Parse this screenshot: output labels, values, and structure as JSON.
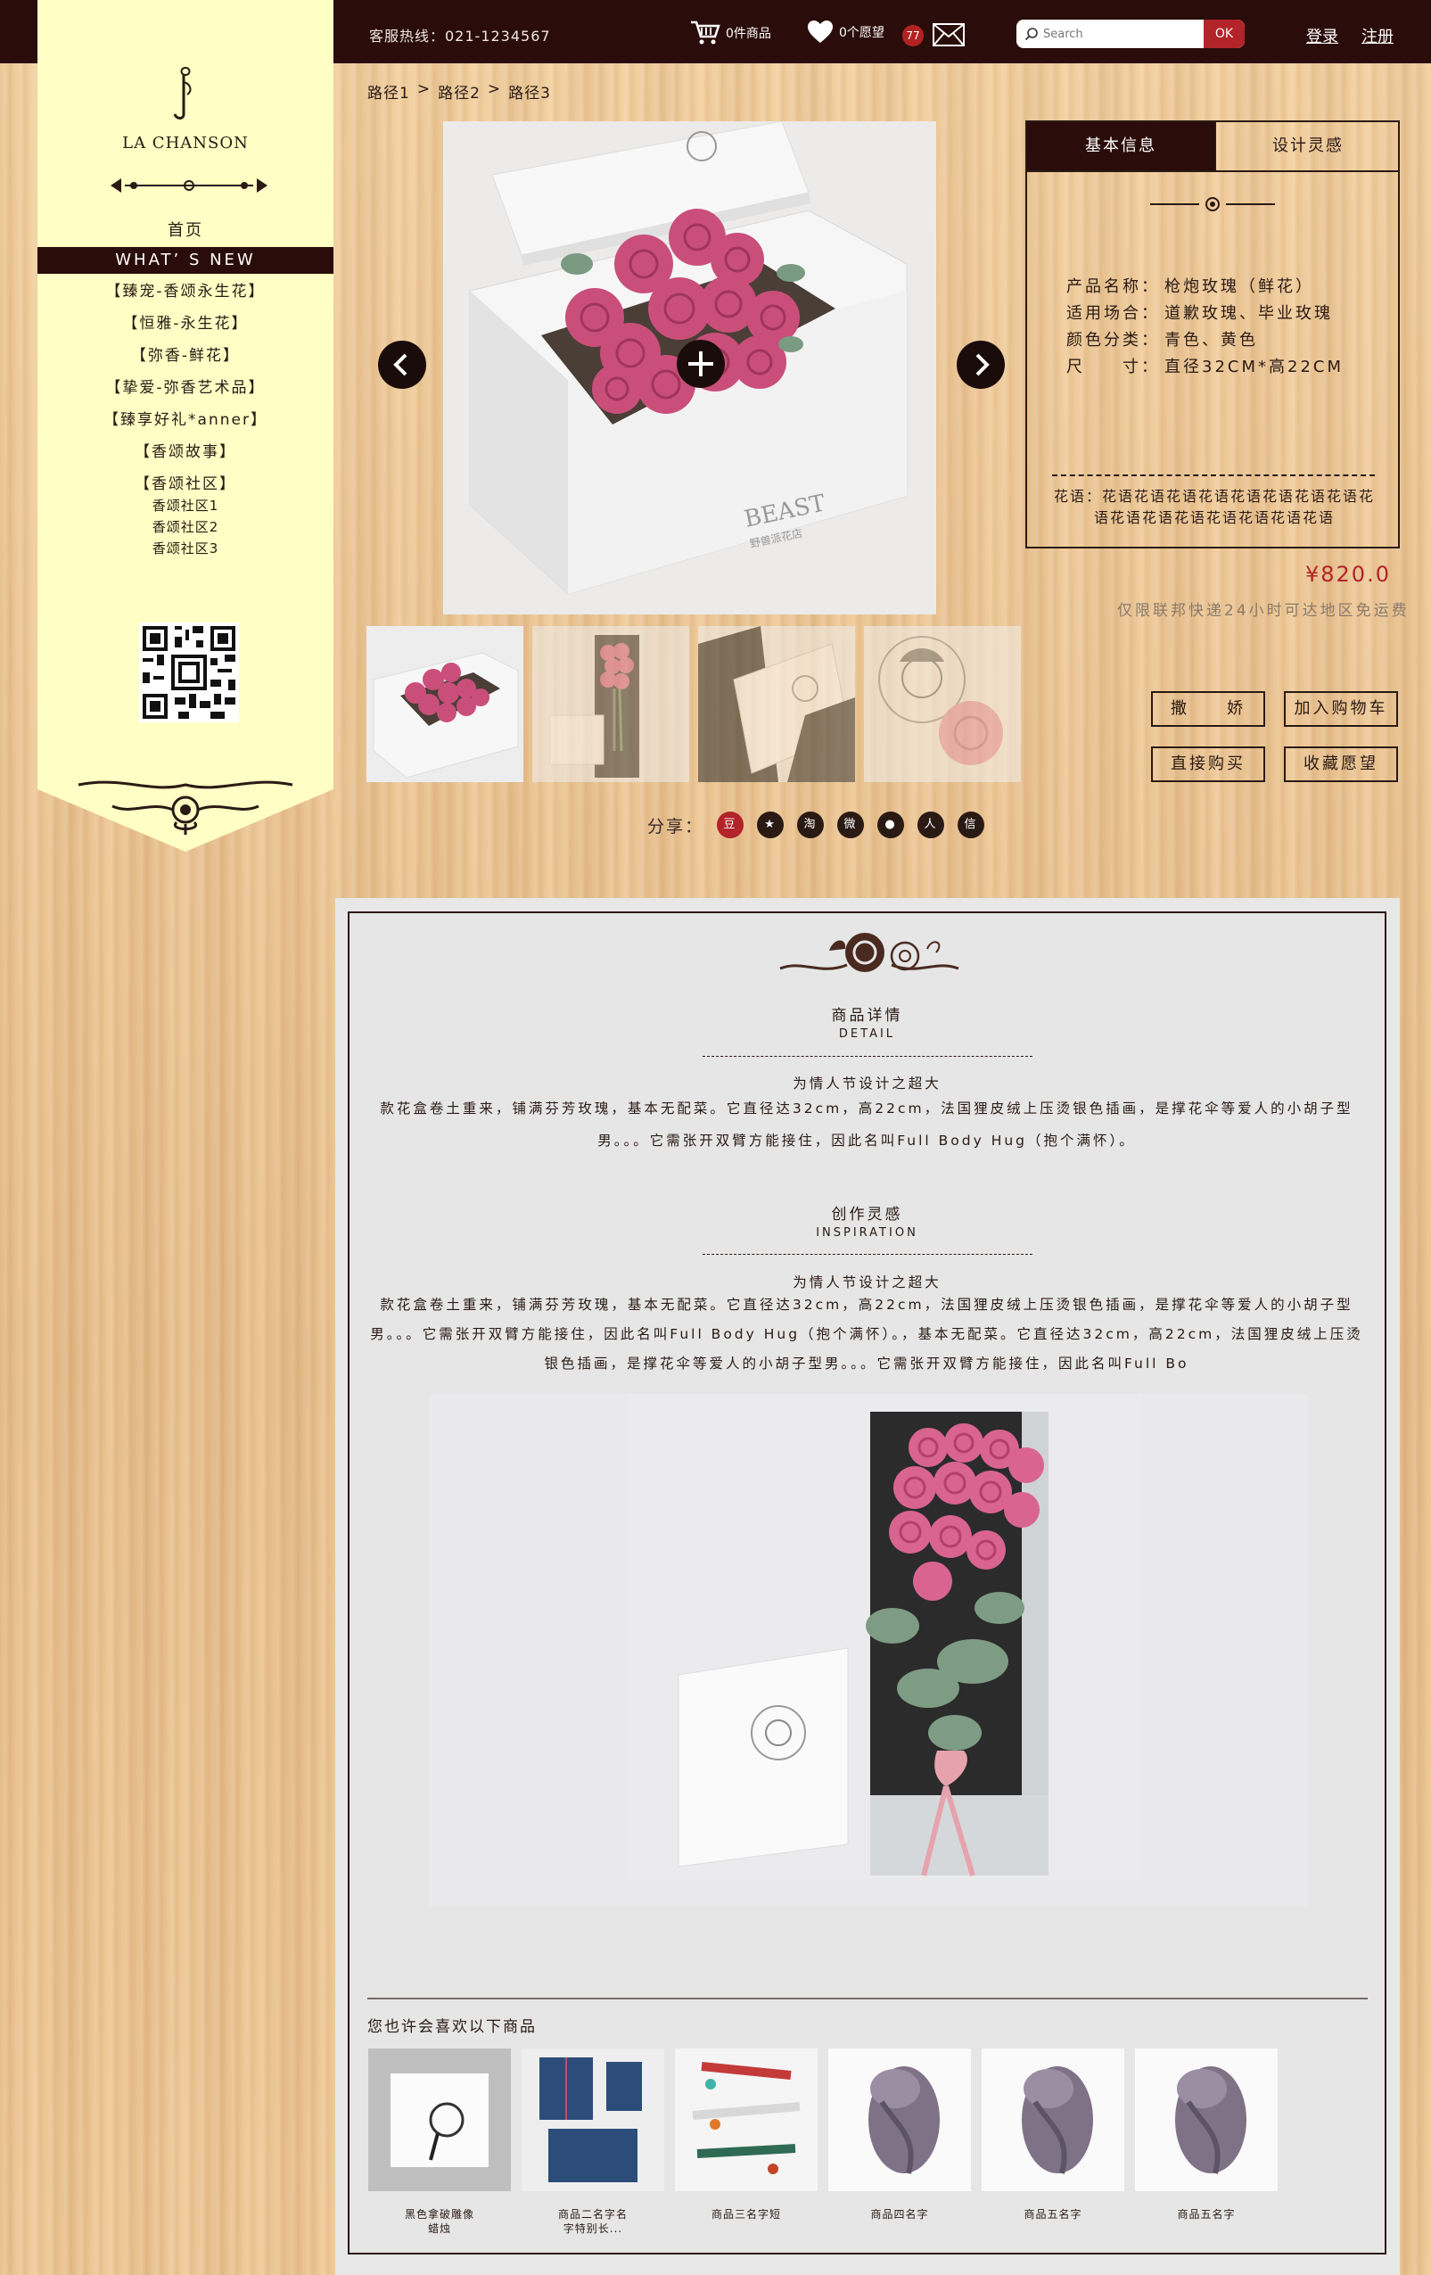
{
  "header": {
    "hotline": "客服热线：021-1234567",
    "cart_label": "0件商品",
    "wish_label": "0个愿望",
    "message_count": "77",
    "search_placeholder": "Search",
    "search_button": "OK",
    "login": "登录",
    "register": "注册"
  },
  "sidebar": {
    "brand": "LA CHANSON",
    "home": "首页",
    "whats_new": "WHAT’ S NEW",
    "items": [
      "【臻宠-香颂永生花】",
      "【恒雅-永生花】",
      "【弥香-鲜花】",
      "【挚爱-弥香艺术品】",
      "【臻享好礼*anner】",
      "【香颂故事】",
      "【香颂社区】"
    ],
    "sub_items": [
      "香颂社区1",
      "香颂社区2",
      "香颂社区3"
    ]
  },
  "breadcrumb": [
    "路径1",
    "路径2",
    "路径3"
  ],
  "breadcrumb_sep": ">",
  "product": {
    "tabs": [
      "基本信息",
      "设计灵感"
    ],
    "specs": [
      {
        "key": "产品名称：",
        "value": "枪炮玫瑰（鲜花）"
      },
      {
        "key": "适用场合：",
        "value": "道歉玫瑰、毕业玫瑰"
      },
      {
        "key": "颜色分类：",
        "value": "青色、黄色"
      },
      {
        "key": "尺　　寸：",
        "value": "直径32CM*高22CM"
      }
    ],
    "flower_language": "花语：花语花语花语花语花语花语花语花语花语花语花语花语花语花语花语花语",
    "price": "¥820.0",
    "delivery_note": "仅限联邦快递24小时可达地区免运费",
    "buttons": [
      "撒　　娇",
      "加入购物车",
      "直接购买",
      "收藏愿望"
    ],
    "box_brand": "BEAST",
    "box_sub": "野兽派花店"
  },
  "share": {
    "label": "分享：",
    "icons": [
      "豆",
      "★",
      "淘",
      "微",
      "●",
      "人",
      "信"
    ]
  },
  "detail": {
    "title": "商品详情",
    "title_en": "DETAIL",
    "subtitle": "为情人节设计之超大",
    "text": "款花盒卷土重来，铺满芬芳玫瑰，基本无配菜。它直径达32cm，高22cm，法国狸皮绒上压烫银色插画，是撑花伞等爱人的小胡子型男。。。它需张开双臂方能接住，因此名叫Full Body Hug（抱个满怀）。"
  },
  "inspiration": {
    "title": "创作灵感",
    "title_en": "INSPIRATION",
    "subtitle": "为情人节设计之超大",
    "text": "款花盒卷土重来，铺满芬芳玫瑰，基本无配菜。它直径达32cm，高22cm，法国狸皮绒上压烫银色插画，是撑花伞等爱人的小胡子型男。。。它需张开双臂方能接住，因此名叫Full Body Hug（抱个满怀）。，基本无配菜。它直径达32cm，高22cm，法国狸皮绒上压烫银色插画，是撑花伞等爱人的小胡子型男。。。它需张开双臂方能接住，因此名叫Full Bo"
  },
  "recommend": {
    "title": "您也许会喜欢以下商品",
    "items": [
      "黑色拿破雕像\n蜡烛",
      "商品二名字名\n字特别长...",
      "商品三名字短",
      "商品四名字",
      "商品五名字",
      "商品五名字"
    ]
  },
  "colors": {
    "header_bg": "#2a0d0a",
    "sidebar_bg": "#fefec5",
    "accent_red": "#b3232a"
  }
}
